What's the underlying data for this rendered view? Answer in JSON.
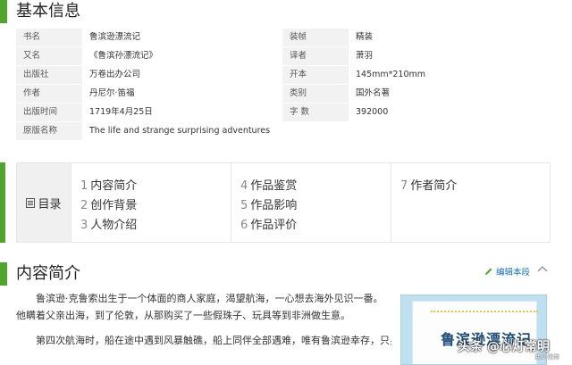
{
  "basic_info": {
    "title": "基本信息",
    "rows": [
      {
        "l1": "书名",
        "v1": "鲁滨逊漂流记",
        "l2": "装帧",
        "v2": "精装"
      },
      {
        "l1": "又名",
        "v1": "《鲁滨孙漂流记》",
        "l2": "译者",
        "v2": "萧羽"
      },
      {
        "l1": "出版社",
        "v1": "万卷出办公司",
        "l2": "开本",
        "v2": "145mm*210mm"
      },
      {
        "l1": "作者",
        "v1": "丹尼尔·笛福",
        "l2": "类别",
        "v2": "国外名著"
      },
      {
        "l1": "出版时间",
        "v1": "1719年4月25日",
        "l2": "字 数",
        "v2": "392000"
      },
      {
        "l1": "原版名称",
        "v1": "The life and strange surprising adventures"
      }
    ]
  },
  "catalog": {
    "label": "目录",
    "items": [
      {
        "num": "1",
        "text": "内容简介"
      },
      {
        "num": "2",
        "text": "创作背景"
      },
      {
        "num": "3",
        "text": "人物介绍"
      },
      {
        "num": "4",
        "text": "作品鉴赏"
      },
      {
        "num": "5",
        "text": "作品影响"
      },
      {
        "num": "6",
        "text": "作品评价"
      },
      {
        "num": "7",
        "text": "作者简介"
      }
    ]
  },
  "intro": {
    "title": "内容简介",
    "edit_label": "编辑本段",
    "paragraphs": [
      "鲁滨逊·克鲁索出生于一个体面的商人家庭，渴望航海，一心想去海外见识一番。他瞒着父亲出海，到了伦敦，从那购买了一些假珠子、玩具等到非洲做生意。",
      "第四次航海时，船在途中遇到风暴触礁，船上同伴全部遇难，唯有鲁滨逊幸存，只身"
    ],
    "cover_title": "鲁滨逊漂流记"
  },
  "watermark": {
    "main": "头条 @心灯常明",
    "sub": "我的视频"
  },
  "colors": {
    "accent": "#4fa62b",
    "link": "#136ec2",
    "label_bg": "#f2f2f2"
  }
}
